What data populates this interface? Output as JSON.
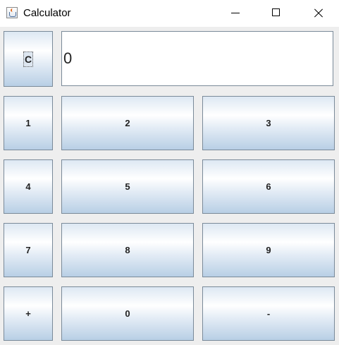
{
  "window": {
    "title": "Calculator",
    "icon": "java-cup-icon"
  },
  "display": {
    "value": "0"
  },
  "buttons": {
    "clear": "C",
    "one": "1",
    "two": "2",
    "three": "3",
    "four": "4",
    "five": "5",
    "six": "6",
    "seven": "7",
    "eight": "8",
    "nine": "9",
    "plus": "+",
    "zero": "0",
    "minus": "-"
  }
}
